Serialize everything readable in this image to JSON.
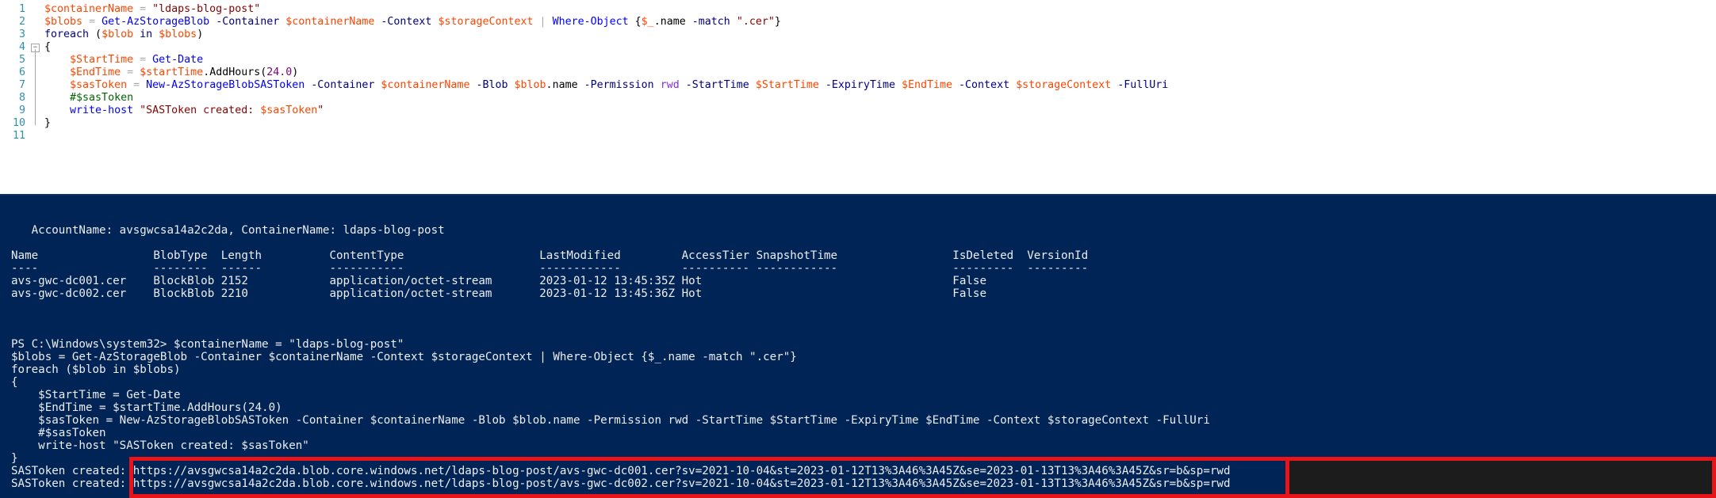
{
  "editor": {
    "lines": [
      {
        "n": "1",
        "parts": [
          [
            "var",
            "$containerName"
          ],
          [
            "grp",
            " "
          ],
          [
            "op",
            "="
          ],
          [
            "grp",
            " "
          ],
          [
            "str",
            "\"ldaps-blog-post\""
          ]
        ]
      },
      {
        "n": "2",
        "parts": [
          [
            "var",
            "$blobs"
          ],
          [
            "grp",
            " "
          ],
          [
            "op",
            "="
          ],
          [
            "grp",
            " "
          ],
          [
            "cmd",
            "Get-AzStorageBlob"
          ],
          [
            "grp",
            " "
          ],
          [
            "prm",
            "-Container"
          ],
          [
            "grp",
            " "
          ],
          [
            "var",
            "$containerName"
          ],
          [
            "grp",
            " "
          ],
          [
            "prm",
            "-Context"
          ],
          [
            "grp",
            " "
          ],
          [
            "var",
            "$storageContext"
          ],
          [
            "grp",
            " "
          ],
          [
            "op",
            "|"
          ],
          [
            "grp",
            " "
          ],
          [
            "cmd",
            "Where-Object"
          ],
          [
            "grp",
            " {"
          ],
          [
            "var",
            "$_"
          ],
          [
            "grp",
            "."
          ],
          [
            "mem",
            "name"
          ],
          [
            "grp",
            " "
          ],
          [
            "prm",
            "-match"
          ],
          [
            "grp",
            " "
          ],
          [
            "str",
            "\".cer\""
          ],
          [
            "grp",
            "}"
          ]
        ]
      },
      {
        "n": "3",
        "parts": [
          [
            "kw",
            "foreach"
          ],
          [
            "grp",
            " ("
          ],
          [
            "var",
            "$blob"
          ],
          [
            "grp",
            " "
          ],
          [
            "kw",
            "in"
          ],
          [
            "grp",
            " "
          ],
          [
            "var",
            "$blobs"
          ],
          [
            "grp",
            ")"
          ]
        ]
      },
      {
        "n": "4",
        "parts": [
          [
            "grp",
            "{"
          ]
        ]
      },
      {
        "n": "5",
        "parts": [
          [
            "grp",
            "    "
          ],
          [
            "var",
            "$StartTime"
          ],
          [
            "grp",
            " "
          ],
          [
            "op",
            "="
          ],
          [
            "grp",
            " "
          ],
          [
            "cmd",
            "Get-Date"
          ]
        ]
      },
      {
        "n": "6",
        "parts": [
          [
            "grp",
            "    "
          ],
          [
            "var",
            "$EndTime"
          ],
          [
            "grp",
            " "
          ],
          [
            "op",
            "="
          ],
          [
            "grp",
            " "
          ],
          [
            "var",
            "$startTime"
          ],
          [
            "grp",
            "."
          ],
          [
            "mem",
            "AddHours"
          ],
          [
            "grp",
            "("
          ],
          [
            "num",
            "24.0"
          ],
          [
            "grp",
            ")"
          ]
        ]
      },
      {
        "n": "7",
        "parts": [
          [
            "grp",
            "    "
          ],
          [
            "var",
            "$sasToken"
          ],
          [
            "grp",
            " "
          ],
          [
            "op",
            "="
          ],
          [
            "grp",
            " "
          ],
          [
            "cmd",
            "New-AzStorageBlobSASToken"
          ],
          [
            "grp",
            " "
          ],
          [
            "prm",
            "-Container"
          ],
          [
            "grp",
            " "
          ],
          [
            "var",
            "$containerName"
          ],
          [
            "grp",
            " "
          ],
          [
            "prm",
            "-Blob"
          ],
          [
            "grp",
            " "
          ],
          [
            "var",
            "$blob"
          ],
          [
            "grp",
            "."
          ],
          [
            "mem",
            "name"
          ],
          [
            "grp",
            " "
          ],
          [
            "prm",
            "-Permission"
          ],
          [
            "grp",
            " "
          ],
          [
            "cmdarg",
            "rwd"
          ],
          [
            "grp",
            " "
          ],
          [
            "prm",
            "-StartTime"
          ],
          [
            "grp",
            " "
          ],
          [
            "var",
            "$StartTime"
          ],
          [
            "grp",
            " "
          ],
          [
            "prm",
            "-ExpiryTime"
          ],
          [
            "grp",
            " "
          ],
          [
            "var",
            "$EndTime"
          ],
          [
            "grp",
            " "
          ],
          [
            "prm",
            "-Context"
          ],
          [
            "grp",
            " "
          ],
          [
            "var",
            "$storageContext"
          ],
          [
            "grp",
            " "
          ],
          [
            "prm",
            "-FullUri"
          ]
        ]
      },
      {
        "n": "8",
        "parts": [
          [
            "grp",
            "    "
          ],
          [
            "cmt",
            "#$sasToken"
          ]
        ]
      },
      {
        "n": "9",
        "parts": [
          [
            "grp",
            "    "
          ],
          [
            "cmd",
            "write-host"
          ],
          [
            "grp",
            " "
          ],
          [
            "str",
            "\"SASToken created: "
          ],
          [
            "var",
            "$sasToken"
          ],
          [
            "str",
            "\""
          ]
        ]
      },
      {
        "n": "10",
        "parts": [
          [
            "grp",
            "}"
          ]
        ]
      },
      {
        "n": "11",
        "parts": []
      }
    ]
  },
  "console": {
    "lines": [
      "",
      "   AccountName: avsgwcsa14a2c2da, ContainerName: ldaps-blog-post",
      "",
      "Name                 BlobType  Length          ContentType                    LastModified         AccessTier SnapshotTime                 IsDeleted  VersionId",
      "----                 --------  ------          -----------                    ------------         ---------- ------------                 ---------  ---------",
      "avs-gwc-dc001.cer    BlockBlob 2152            application/octet-stream       2023-01-12 13:45:35Z Hot                                     False",
      "avs-gwc-dc002.cer    BlockBlob 2210            application/octet-stream       2023-01-12 13:45:36Z Hot                                     False",
      "",
      "",
      "",
      "PS C:\\Windows\\system32> $containerName = \"ldaps-blog-post\"",
      "$blobs = Get-AzStorageBlob -Container $containerName -Context $storageContext | Where-Object {$_.name -match \".cer\"}",
      "foreach ($blob in $blobs)",
      "{",
      "    $StartTime = Get-Date",
      "    $EndTime = $startTime.AddHours(24.0)",
      "    $sasToken = New-AzStorageBlobSASToken -Container $containerName -Blob $blob.name -Permission rwd -StartTime $StartTime -ExpiryTime $EndTime -Context $storageContext -FullUri",
      "    #$sasToken",
      "    write-host \"SASToken created: $sasToken\"",
      "}",
      "SASToken created: https://avsgwcsa14a2c2da.blob.core.windows.net/ldaps-blog-post/avs-gwc-dc001.cer?sv=2021-10-04&st=2023-01-12T13%3A46%3A45Z&se=2023-01-13T13%3A46%3A45Z&sr=b&sp=rwd",
      "SASToken created: https://avsgwcsa14a2c2da.blob.core.windows.net/ldaps-blog-post/avs-gwc-dc002.cer?sv=2021-10-04&st=2023-01-12T13%3A46%3A45Z&se=2023-01-13T13%3A46%3A45Z&sr=b&sp=rwd"
    ]
  }
}
